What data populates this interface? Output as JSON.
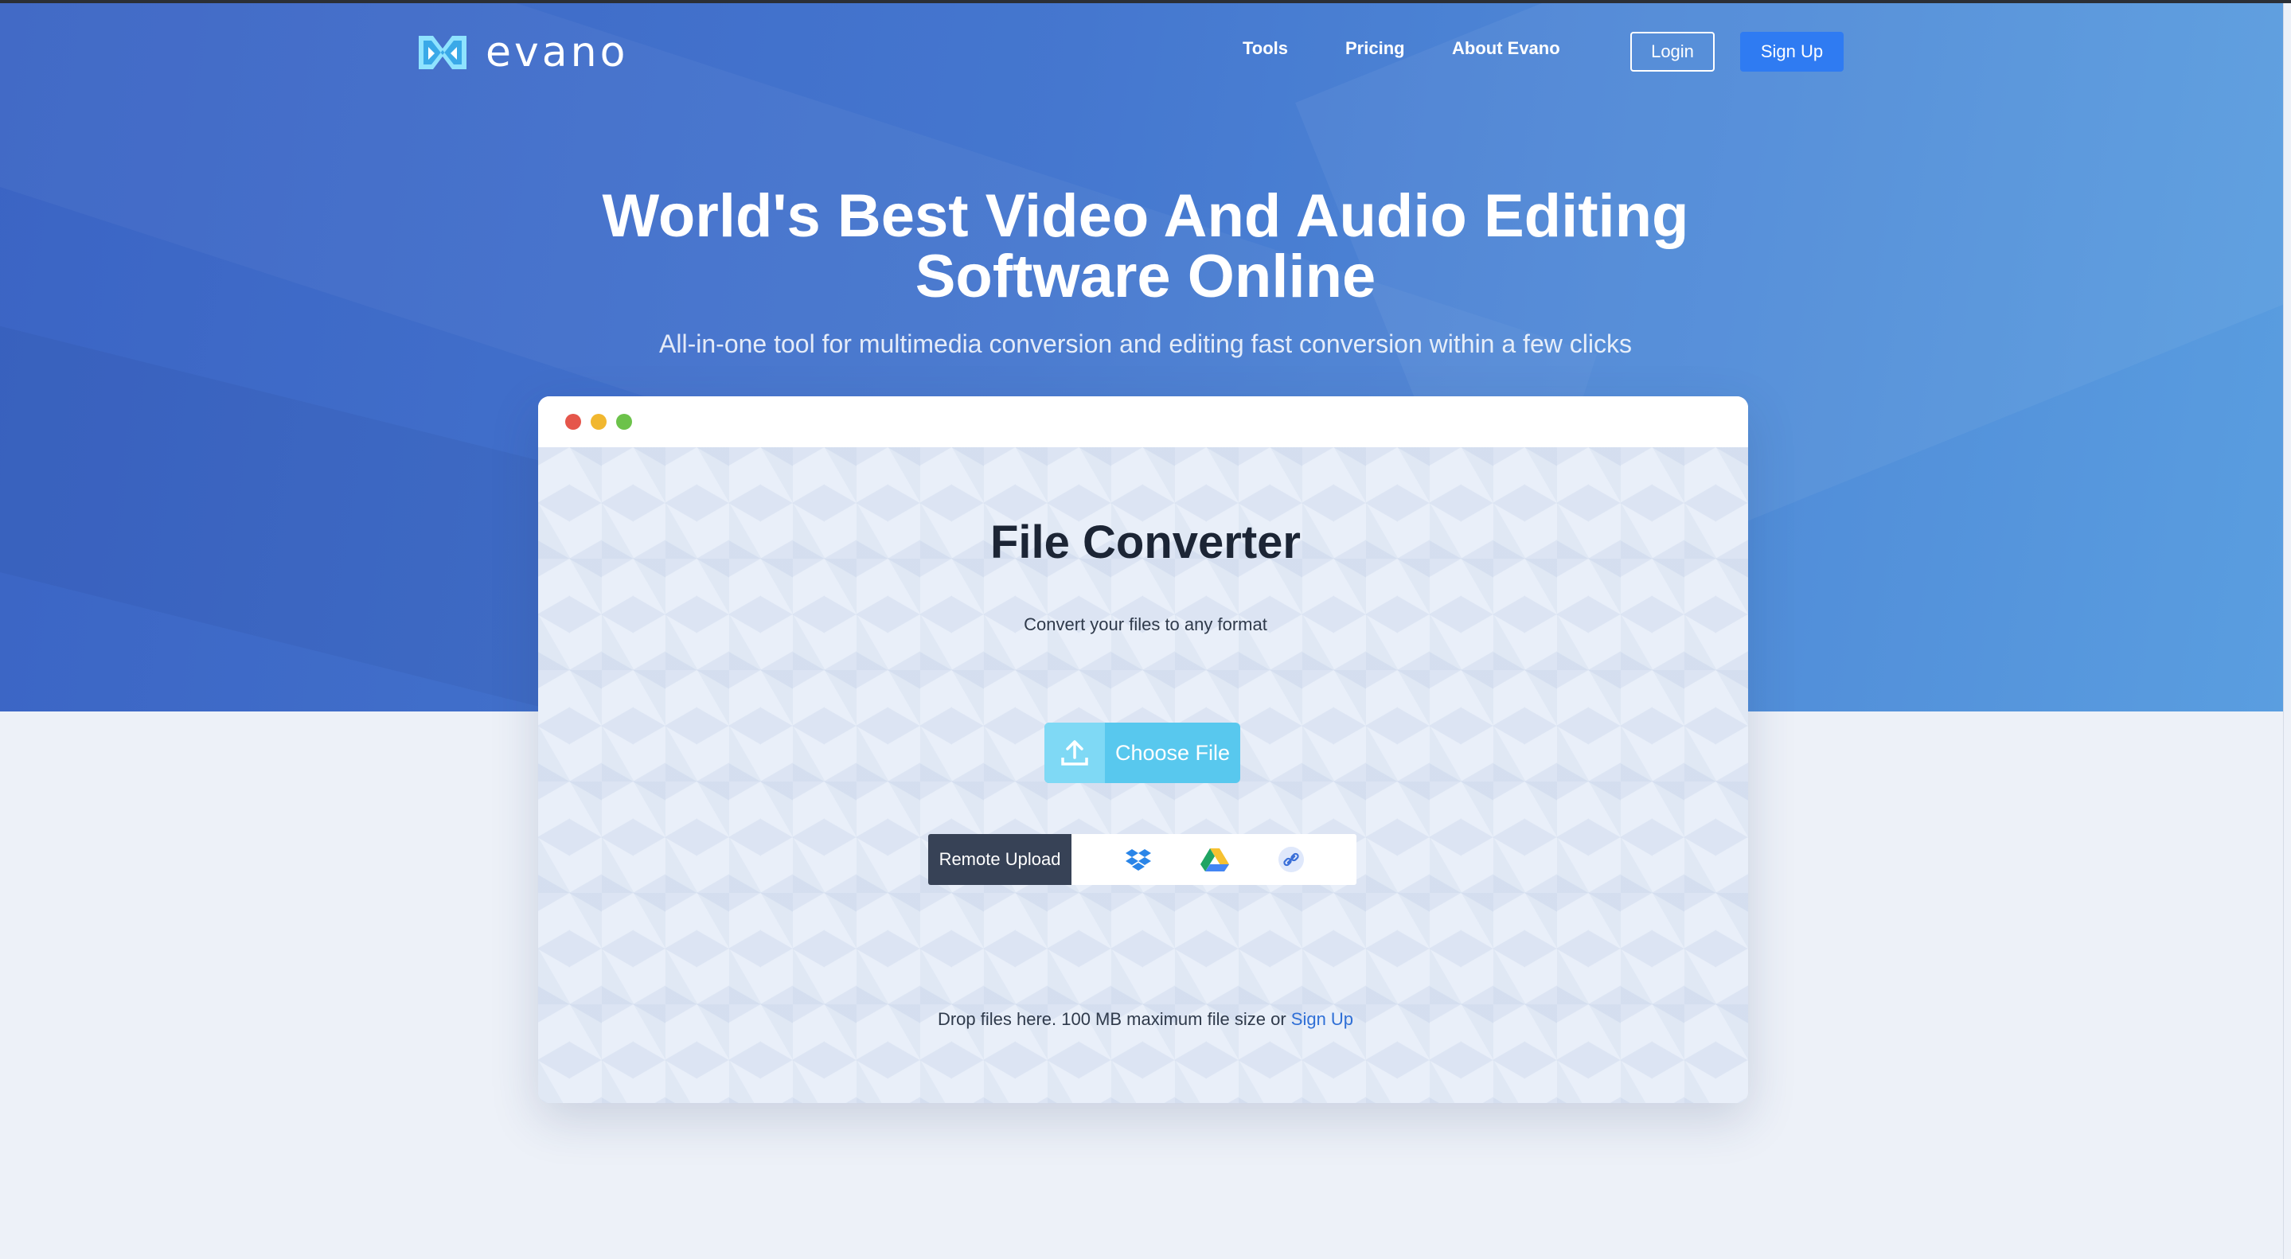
{
  "header": {
    "logo_text": "evano",
    "nav": [
      "Tools",
      "Pricing",
      "About Evano"
    ],
    "login_label": "Login",
    "signup_label": "Sign Up"
  },
  "hero": {
    "headline_line1": "World's Best Video And Audio Editing",
    "headline_line2": "Software Online",
    "subheadline": "All-in-one tool for multimedia conversion and editing fast conversion within a few clicks"
  },
  "converter": {
    "window_dots": [
      "#e5564b",
      "#f1b72f",
      "#6cc24a"
    ],
    "title": "File Converter",
    "subtitle": "Convert your files to any format",
    "choose_file_label": "Choose File",
    "remote_upload_label": "Remote Upload",
    "remote_sources": [
      "dropbox-icon",
      "google-drive-icon",
      "link-icon"
    ],
    "drop_text": "Drop files here. 100 MB maximum file size or",
    "drop_link": "Sign Up"
  },
  "colors": {
    "hero_start": "#3b64c4",
    "hero_end": "#5a9ee0",
    "signup_button": "#2f7bf2",
    "choose_file": "#58c8ee",
    "remote_label_bg": "#374256",
    "link": "#2f6fd6"
  }
}
